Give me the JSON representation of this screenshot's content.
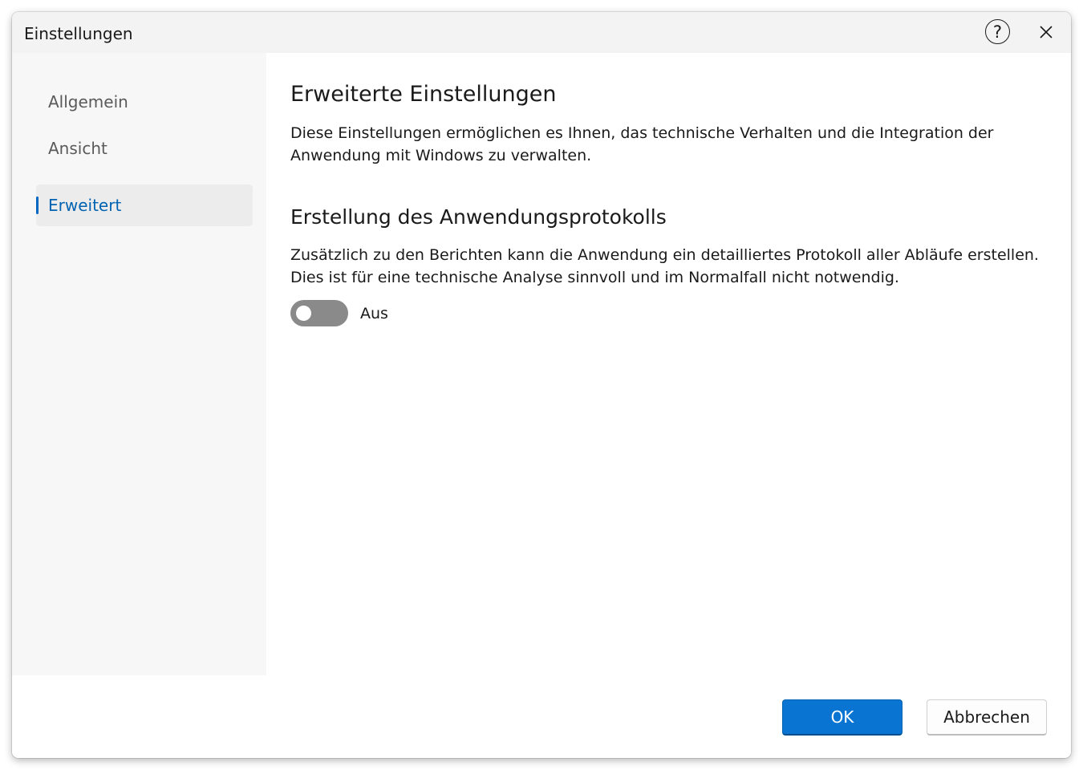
{
  "window": {
    "title": "Einstellungen",
    "help_symbol": "?",
    "close_icon": "close-icon"
  },
  "sidebar": {
    "items": [
      {
        "label": "Allgemein",
        "active": false
      },
      {
        "label": "Ansicht",
        "active": false
      },
      {
        "label": "Erweitert",
        "active": true
      }
    ]
  },
  "content": {
    "heading": "Erweiterte Einstellungen",
    "description": "Diese Einstellungen ermöglichen es Ihnen, das technische Verhalten und die Integration der Anwendung mit Windows zu verwalten.",
    "section": {
      "heading": "Erstellung des Anwendungsprotokolls",
      "description": "Zusätzlich zu den Berichten kann die Anwendung ein detailliertes Protokoll aller Abläufe erstellen. Dies ist für eine technische Analyse sinnvoll und im Normalfall nicht notwendig.",
      "toggle": {
        "on": false,
        "state_label": "Aus"
      }
    }
  },
  "footer": {
    "ok_label": "OK",
    "cancel_label": "Abbrechen"
  },
  "colors": {
    "accent": "#0067c0",
    "ok_button": "#0a74d2",
    "toggle_off": "#8a8a8a",
    "sidebar_bg": "#f7f7f7",
    "titlebar_bg": "#f3f3f3"
  }
}
